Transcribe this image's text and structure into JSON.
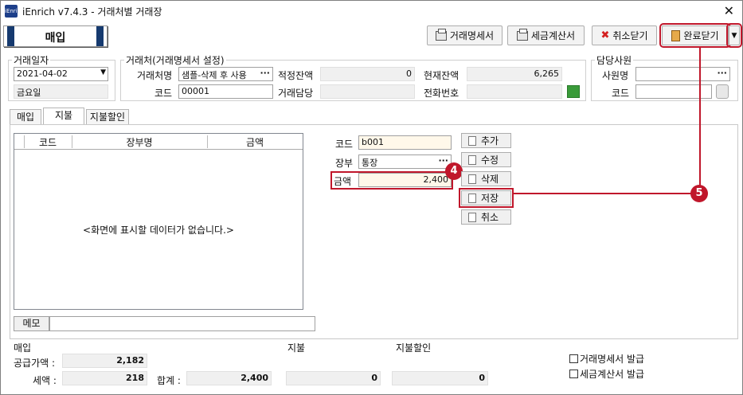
{
  "window": {
    "logo": "iEnrich",
    "title": "iEnrich v7.4.3 - 거래처별 거래장",
    "close_icon": "close-icon"
  },
  "mode_button": "매입",
  "toolbar": {
    "statement_label": "거래명세서",
    "tax_invoice_label": "세금계산서",
    "cancel_close_label": "취소닫기",
    "complete_close_label": "완료닫기"
  },
  "trade_date": {
    "legend": "거래일자",
    "value": "2021-04-02",
    "weekday": "금요일"
  },
  "client": {
    "legend": "거래처(거래명세서 설정)",
    "name_label": "거래처명",
    "name_value": "샘플-삭제 후 사용",
    "code_label": "코드",
    "code_value": "00001",
    "opening_balance_label": "적정잔액",
    "opening_balance_value": "0",
    "current_balance_label": "현재잔액",
    "current_balance_value": "6,265",
    "contact_label": "거래담당",
    "contact_value": "",
    "phone_label": "전화번호",
    "phone_value": ""
  },
  "staff": {
    "legend": "담당사원",
    "name_label": "사원명",
    "name_value": "",
    "code_label": "코드",
    "code_value": ""
  },
  "tabs": [
    {
      "label": "매입"
    },
    {
      "label": "지불"
    },
    {
      "label": "지불할인"
    }
  ],
  "grid": {
    "columns": [
      "코드",
      "장부명",
      "금액"
    ],
    "empty_message": "<화면에 표시할 데이터가 없습니다.>"
  },
  "memo": {
    "label": "메모",
    "value": ""
  },
  "payment_form": {
    "code_label": "코드",
    "code_value": "b001",
    "ledger_label": "장부",
    "ledger_value": "통장",
    "amount_label": "금액",
    "amount_value": "2,400"
  },
  "side_buttons": {
    "add": "추가",
    "edit": "수정",
    "delete": "삭제",
    "save": "저장",
    "cancel": "취소"
  },
  "callouts": {
    "four": "4",
    "five": "5"
  },
  "summary": {
    "purchase_legend": "매입",
    "supply_label": "공급가액 :",
    "supply_value": "2,182",
    "tax_label": "세액 :",
    "tax_value": "218",
    "total_label": "합계 :",
    "total_value": "2,400",
    "payment_legend": "지불",
    "payment_value": "0",
    "discount_legend": "지불할인",
    "discount_value": "0"
  },
  "checkboxes": {
    "statement_issue": "거래명세서 발급",
    "tax_invoice_issue": "세금계산서 발급"
  },
  "colors": {
    "highlight": "#c0172b",
    "brand": "#163a6f"
  }
}
